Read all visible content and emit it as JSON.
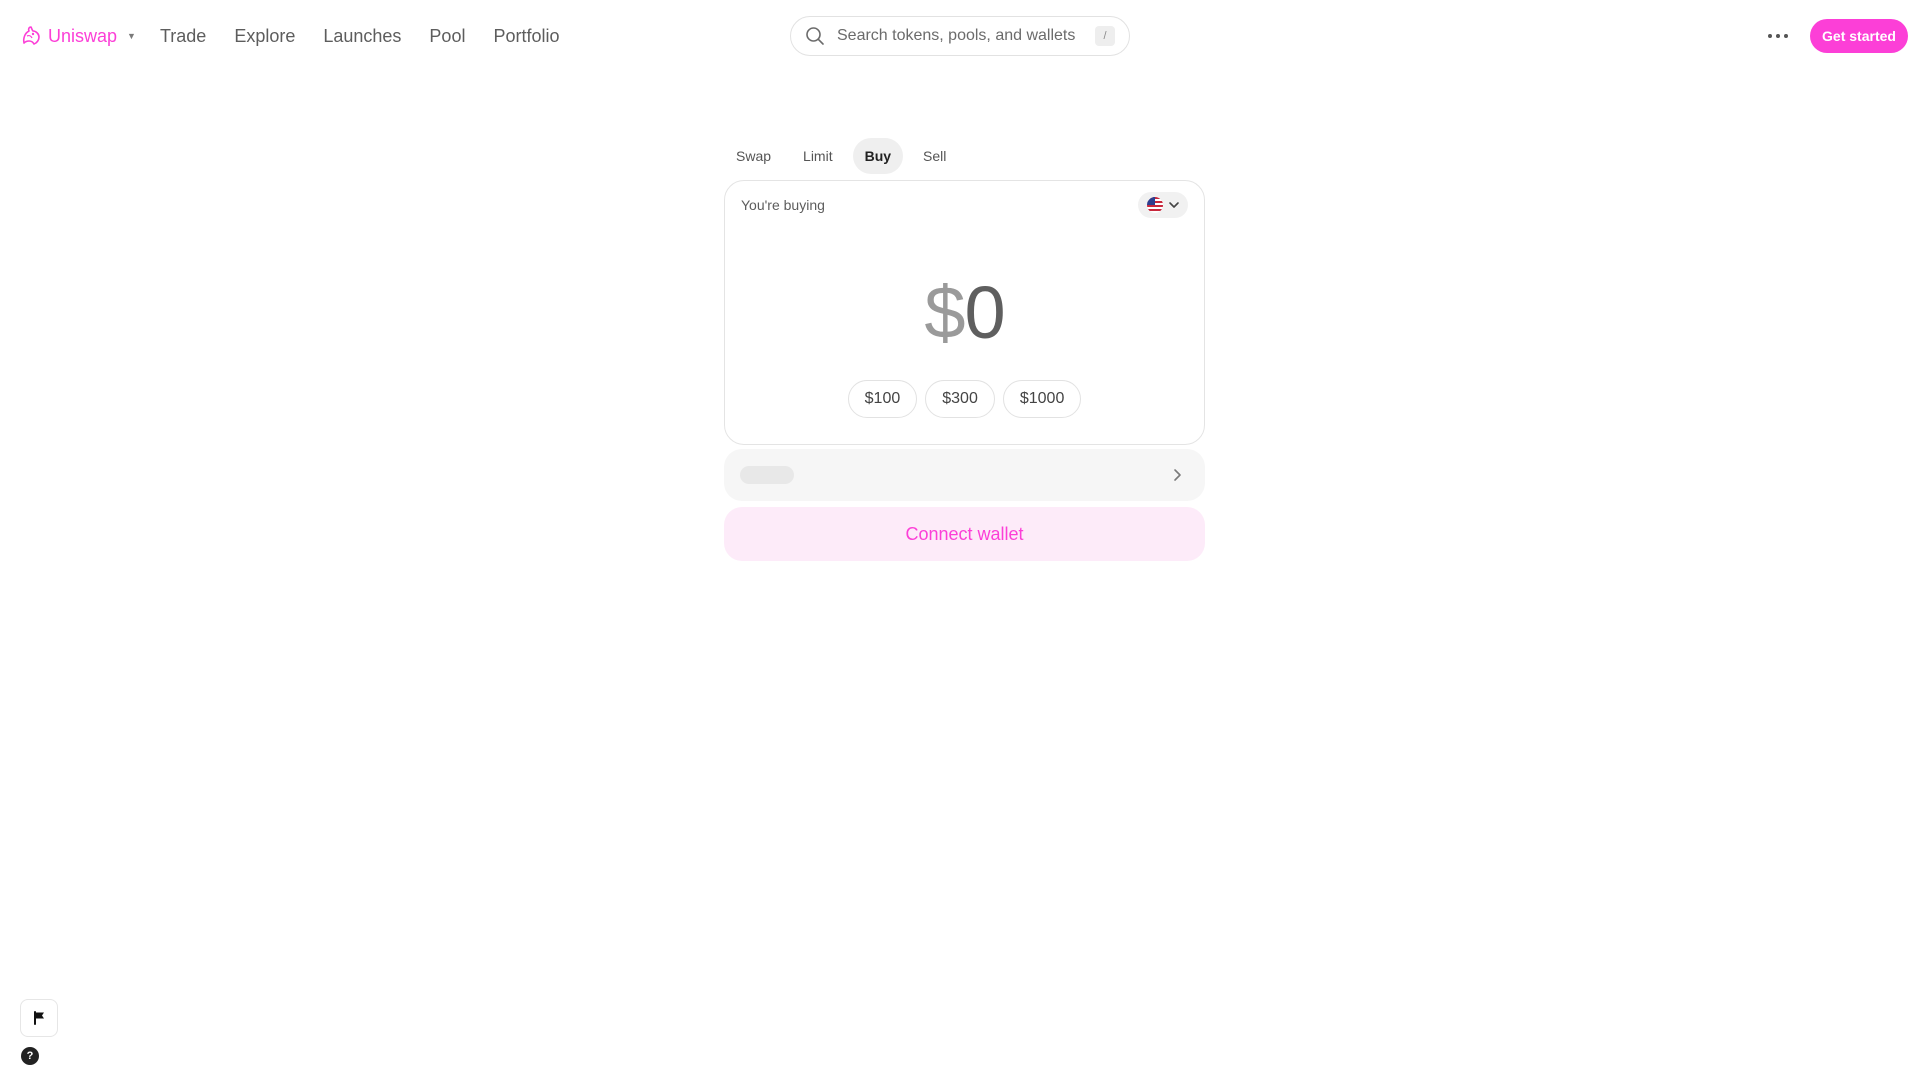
{
  "colors": {
    "brand": "#FC3FD7",
    "brand_soft": "#FDEBF9"
  },
  "nav": {
    "brand": {
      "name": "Uniswap",
      "logo_icon": "unicorn-logo-icon",
      "caret_icon": "caret-down-icon"
    },
    "links": [
      "Trade",
      "Explore",
      "Launches",
      "Pool",
      "Portfolio"
    ],
    "search": {
      "placeholder": "Search tokens, pools, and wallets",
      "value": "",
      "shortcut": "/",
      "icon": "search-icon"
    },
    "more_icon": "more-horizontal-icon",
    "cta_label": "Get started"
  },
  "widget": {
    "tabs": [
      {
        "label": "Swap",
        "active": false
      },
      {
        "label": "Limit",
        "active": false
      },
      {
        "label": "Buy",
        "active": true
      },
      {
        "label": "Sell",
        "active": false
      }
    ],
    "buy_card": {
      "label": "You're buying",
      "country_icon": "us-flag-icon",
      "currency_symbol": "$",
      "amount": "0",
      "presets": [
        "$100",
        "$300",
        "$1000"
      ]
    },
    "token_row_chevron_icon": "chevron-right-icon",
    "connect_label": "Connect wallet"
  },
  "footer": {
    "flag_icon": "flag-icon",
    "help_label": "?",
    "help_icon": "help-icon"
  }
}
